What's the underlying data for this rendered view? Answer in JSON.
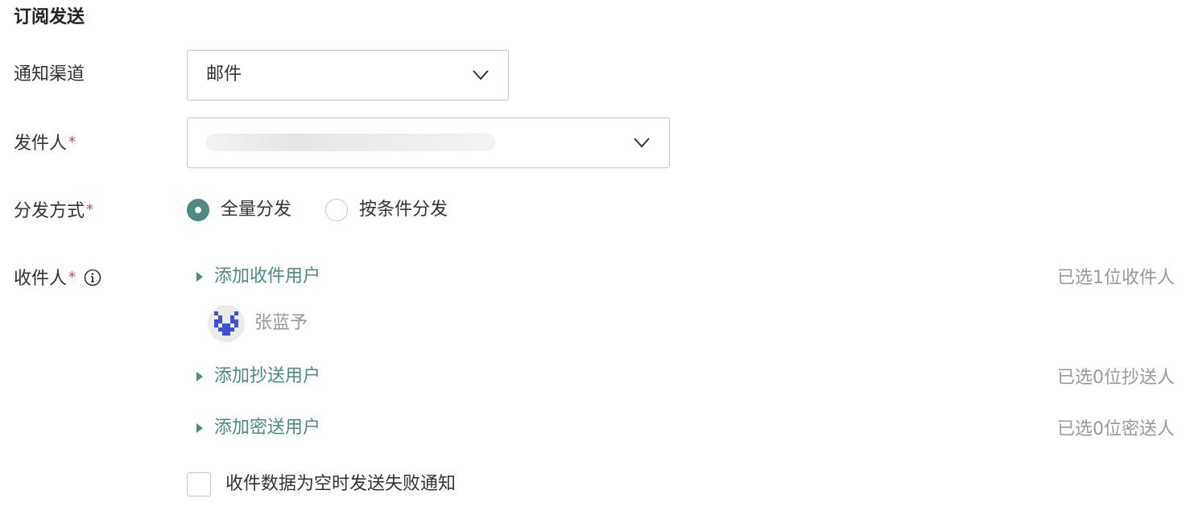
{
  "section": {
    "title": "订阅发送"
  },
  "channel": {
    "label": "通知渠道",
    "value": "邮件",
    "icon": "chevron-down-icon"
  },
  "sender": {
    "label": "发件人",
    "required_mark": "*",
    "icon": "chevron-down-icon"
  },
  "distribution": {
    "label": "分发方式",
    "required_mark": "*",
    "options": [
      {
        "label": "全量分发",
        "selected": true
      },
      {
        "label": "按条件分发",
        "selected": false
      }
    ]
  },
  "recipients": {
    "label": "收件人",
    "required_mark": "*",
    "info_icon": "info-icon",
    "to": {
      "link": "添加收件用户",
      "count": "已选1位收件人"
    },
    "to_users": [
      {
        "name": "张蓝予"
      }
    ],
    "cc": {
      "link": "添加抄送用户",
      "count": "已选0位抄送人"
    },
    "bcc": {
      "link": "添加密送用户",
      "count": "已选0位密送人"
    }
  },
  "empty_data_notice": {
    "label": "收件数据为空时发送失败通知",
    "checked": false
  },
  "colors": {
    "accent": "#4e8a84",
    "required": "#e04040",
    "muted": "#9a9a9a",
    "border": "#c9c9c9"
  }
}
